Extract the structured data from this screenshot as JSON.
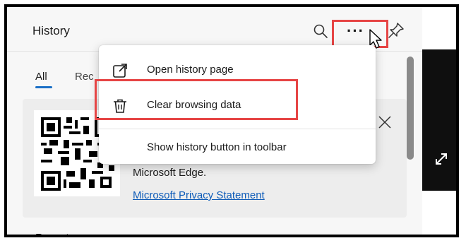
{
  "header": {
    "title": "History"
  },
  "tabs": [
    {
      "label": "All"
    },
    {
      "label": "Rec"
    }
  ],
  "menu": {
    "items": [
      {
        "label": "Open history page",
        "icon": "open-external-icon"
      },
      {
        "label": "Clear browsing data",
        "icon": "trash-icon"
      },
      {
        "label": "Show history button in toolbar",
        "icon": ""
      }
    ]
  },
  "card": {
    "text": "Microsoft Edge.",
    "link": "Microsoft Privacy Statement"
  },
  "section": {
    "label": "Recent"
  },
  "colors": {
    "highlight": "#e64545",
    "link": "#0f5cb8",
    "tab_underline": "#1a6fc6"
  }
}
